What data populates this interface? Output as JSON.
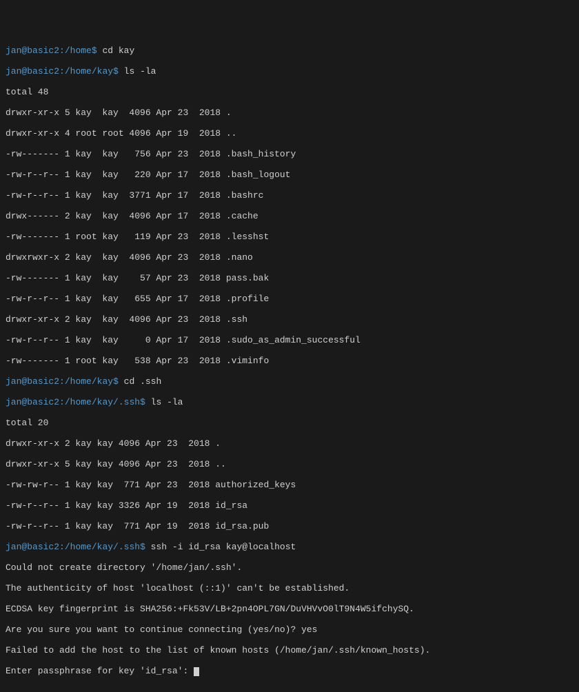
{
  "prompts": {
    "p1": {
      "user": "jan",
      "host": "basic2",
      "path": "/home",
      "cmd": "cd kay"
    },
    "p2": {
      "user": "jan",
      "host": "basic2",
      "path": "/home/kay",
      "cmd": "ls -la"
    },
    "p3": {
      "user": "jan",
      "host": "basic2",
      "path": "/home/kay",
      "cmd": "cd .ssh"
    },
    "p4": {
      "user": "jan",
      "host": "basic2",
      "path": "/home/kay/.ssh",
      "cmd": "ls -la"
    },
    "p5": {
      "user": "jan",
      "host": "basic2",
      "path": "/home/kay/.ssh",
      "cmd": "ssh -i id_rsa kay@localhost"
    }
  },
  "ls1": {
    "total": "total 48",
    "r0": "drwxr-xr-x 5 kay  kay  4096 Apr 23  2018 .",
    "r1": "drwxr-xr-x 4 root root 4096 Apr 19  2018 ..",
    "r2": "-rw------- 1 kay  kay   756 Apr 23  2018 .bash_history",
    "r3": "-rw-r--r-- 1 kay  kay   220 Apr 17  2018 .bash_logout",
    "r4": "-rw-r--r-- 1 kay  kay  3771 Apr 17  2018 .bashrc",
    "r5": "drwx------ 2 kay  kay  4096 Apr 17  2018 .cache",
    "r6": "-rw------- 1 root kay   119 Apr 23  2018 .lesshst",
    "r7": "drwxrwxr-x 2 kay  kay  4096 Apr 23  2018 .nano",
    "r8": "-rw------- 1 kay  kay    57 Apr 23  2018 pass.bak",
    "r9": "-rw-r--r-- 1 kay  kay   655 Apr 17  2018 .profile",
    "r10": "drwxr-xr-x 2 kay  kay  4096 Apr 23  2018 .ssh",
    "r11": "-rw-r--r-- 1 kay  kay     0 Apr 17  2018 .sudo_as_admin_successful",
    "r12": "-rw------- 1 root kay   538 Apr 23  2018 .viminfo"
  },
  "ls2": {
    "total": "total 20",
    "r0": "drwxr-xr-x 2 kay kay 4096 Apr 23  2018 .",
    "r1": "drwxr-xr-x 5 kay kay 4096 Apr 23  2018 ..",
    "r2": "-rw-rw-r-- 1 kay kay  771 Apr 23  2018 authorized_keys",
    "r3": "-rw-r--r-- 1 kay kay 3326 Apr 19  2018 id_rsa",
    "r4": "-rw-r--r-- 1 kay kay  771 Apr 19  2018 id_rsa.pub"
  },
  "ssh": {
    "l0": "Could not create directory '/home/jan/.ssh'.",
    "l1": "The authenticity of host 'localhost (::1)' can't be established.",
    "l2": "ECDSA key fingerprint is SHA256:+Fk53V/LB+2pn4OPL7GN/DuVHVvO0lT9N4W5ifchySQ.",
    "l3": "Are you sure you want to continue connecting (yes/no)? yes",
    "l4": "Failed to add the host to the list of known hosts (/home/jan/.ssh/known_hosts).",
    "l5": "Enter passphrase for key 'id_rsa': "
  }
}
